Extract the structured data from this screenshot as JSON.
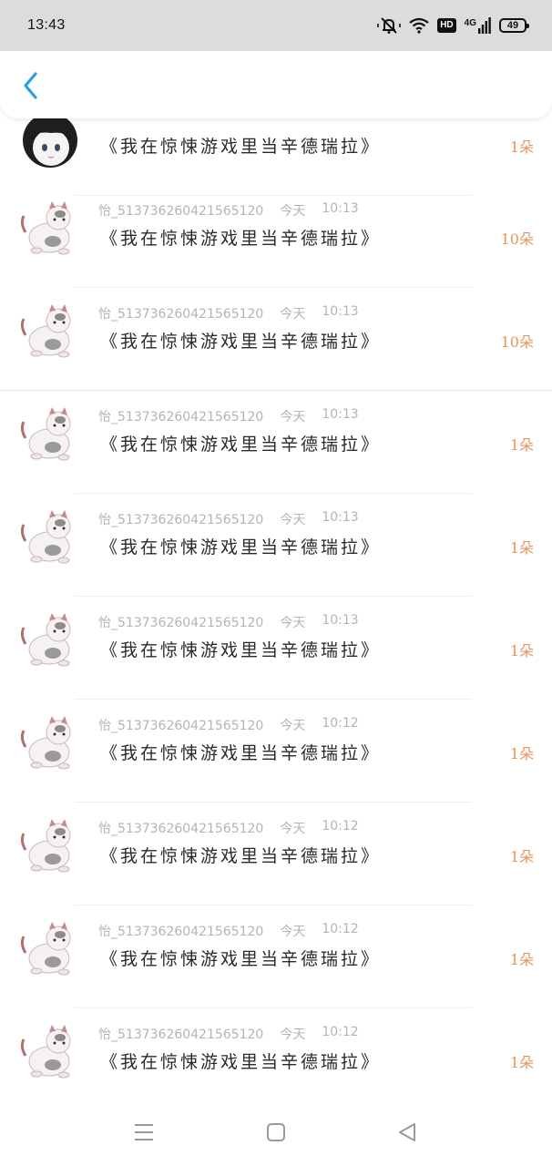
{
  "status_bar": {
    "time": "13:43",
    "network": "4G",
    "hd": "HD",
    "battery": "49",
    "icons": [
      "mute-bell-icon",
      "wifi-icon",
      "hd-icon",
      "signal-icon",
      "battery-icon"
    ]
  },
  "header": {
    "back_icon": "chevron-left-icon",
    "accent_color": "#2b9de6"
  },
  "rows": [
    {
      "meta_user": "",
      "meta_day": "",
      "meta_time": "",
      "title": "《我在惊悚游戏里当辛德瑞拉》",
      "count": "1朵",
      "avatar": "anime-girl-avatar"
    },
    {
      "meta_user": "怡_513736260421565120",
      "meta_day": "今天",
      "meta_time": "10:13",
      "title": "《我在惊悚游戏里当辛德瑞拉》",
      "count": "10朵",
      "avatar": "cat-avatar"
    },
    {
      "meta_user": "怡_513736260421565120",
      "meta_day": "今天",
      "meta_time": "10:13",
      "title": "《我在惊悚游戏里当辛德瑞拉》",
      "count": "10朵",
      "avatar": "cat-avatar"
    },
    {
      "meta_user": "怡_513736260421565120",
      "meta_day": "今天",
      "meta_time": "10:13",
      "title": "《我在惊悚游戏里当辛德瑞拉》",
      "count": "1朵",
      "avatar": "cat-avatar"
    },
    {
      "meta_user": "怡_513736260421565120",
      "meta_day": "今天",
      "meta_time": "10:13",
      "title": "《我在惊悚游戏里当辛德瑞拉》",
      "count": "1朵",
      "avatar": "cat-avatar"
    },
    {
      "meta_user": "怡_513736260421565120",
      "meta_day": "今天",
      "meta_time": "10:13",
      "title": "《我在惊悚游戏里当辛德瑞拉》",
      "count": "1朵",
      "avatar": "cat-avatar"
    },
    {
      "meta_user": "怡_513736260421565120",
      "meta_day": "今天",
      "meta_time": "10:12",
      "title": "《我在惊悚游戏里当辛德瑞拉》",
      "count": "1朵",
      "avatar": "cat-avatar"
    },
    {
      "meta_user": "怡_513736260421565120",
      "meta_day": "今天",
      "meta_time": "10:12",
      "title": "《我在惊悚游戏里当辛德瑞拉》",
      "count": "1朵",
      "avatar": "cat-avatar"
    },
    {
      "meta_user": "怡_513736260421565120",
      "meta_day": "今天",
      "meta_time": "10:12",
      "title": "《我在惊悚游戏里当辛德瑞拉》",
      "count": "1朵",
      "avatar": "cat-avatar"
    },
    {
      "meta_user": "怡_513736260421565120",
      "meta_day": "今天",
      "meta_time": "10:12",
      "title": "《我在惊悚游戏里当辛德瑞拉》",
      "count": "1朵",
      "avatar": "cat-avatar"
    }
  ],
  "nav_bar": {
    "icons": [
      "menu-icon",
      "home-square-icon",
      "back-triangle-icon"
    ]
  },
  "colors": {
    "count": "#e8935a",
    "meta": "#b4b4b4",
    "title": "#2a2a2a"
  }
}
